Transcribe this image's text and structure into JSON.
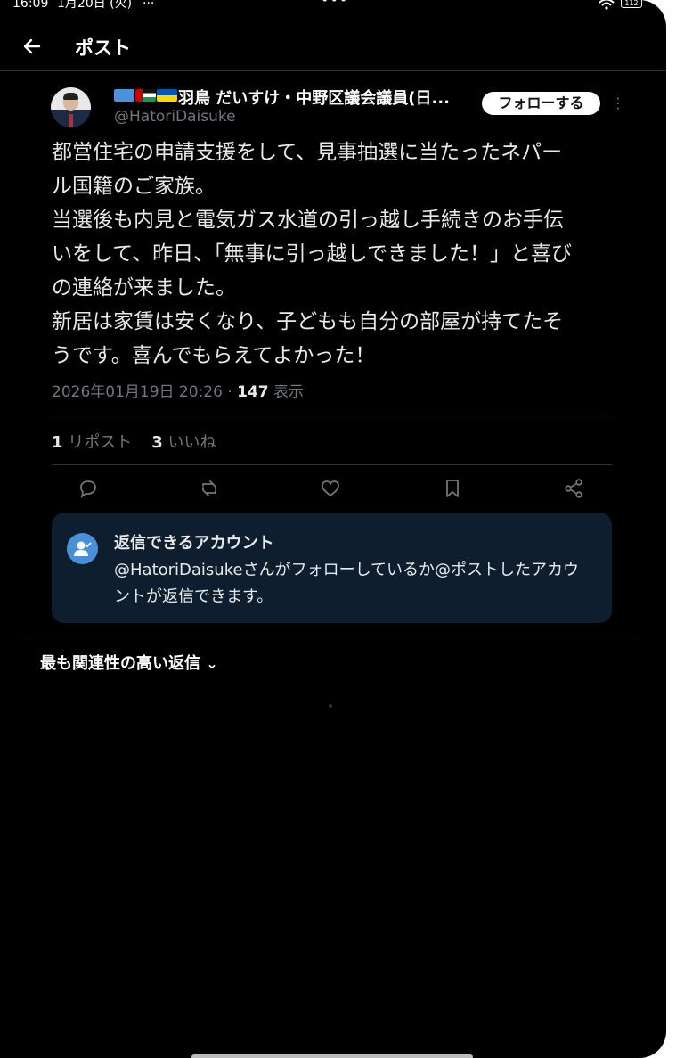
{
  "status_bar": {
    "time": "16:09",
    "date": "1月20日 (火)",
    "notif": "···",
    "center_dots": "•••",
    "battery": "112"
  },
  "header": {
    "title": "ポスト"
  },
  "author": {
    "display_name": "羽鳥 だいすけ・中野区議会議員(日...",
    "handle": "@HatoriDaisuke",
    "flags": [
      "un-flag",
      "palestine-flag",
      "ukraine-flag"
    ]
  },
  "follow_button": "フォローする",
  "more_icon": "⋮",
  "post": {
    "lines": [
      "都営住宅の申請支援をして、見事抽選に当たったネパー",
      "ル国籍のご家族。",
      "当選後も内見と電気ガス水道の引っ越し手続きのお手伝",
      "いをして、昨日、「無事に引っ越しできました！」と喜び",
      "の連絡が来ました。",
      "新居は家賃は安くなり、子どもも自分の部屋が持てたそ",
      "うです。喜んでもらえてよかった！"
    ]
  },
  "meta": {
    "datetime": "2026年01月19日 20:26 · ",
    "views": "147",
    "views_label": " 表示"
  },
  "stats": {
    "reposts": "1",
    "reposts_label": "リポスト",
    "likes": "3",
    "likes_label": "いいね"
  },
  "actions": [
    "reply-icon",
    "repost-icon",
    "like-icon",
    "bookmark-icon",
    "share-icon"
  ],
  "reply_restriction": {
    "title": "返信できるアカウント",
    "desc": "@HatoriDaisukeさんがフォローしているか@ポストしたアカウントが返信できます。"
  },
  "replies_sort": {
    "label": "最も関連性の高い返信",
    "chevron": "⌄"
  },
  "colors": {
    "background": "#000000",
    "text": "#e7e9ea",
    "muted": "#71767b",
    "card": "#0f1e2e",
    "accent": "#4a90d9"
  }
}
